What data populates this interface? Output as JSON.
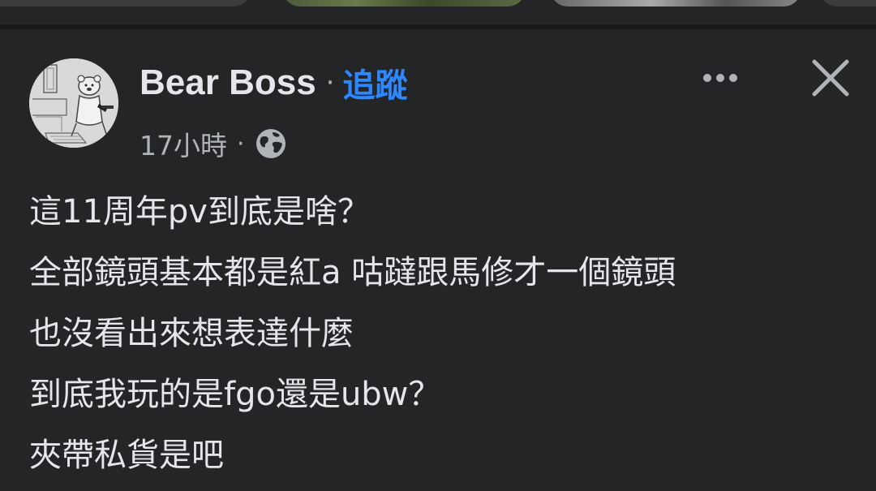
{
  "post": {
    "author": "Bear Boss",
    "separator": "·",
    "follow_label": "追蹤",
    "timestamp": "17小時",
    "meta_separator": "·",
    "privacy_icon": "globe-icon",
    "more_icon": "more-horizontal-icon",
    "close_icon": "close-icon",
    "lines": [
      "這11周年pv到底是啥？",
      "全部鏡頭基本都是紅a 咕躂跟馬修才一個鏡頭",
      "也沒看出來想表達什麼",
      "到底我玩的是fgo還是ubw？",
      "夾帶私貨是吧"
    ]
  },
  "colors": {
    "background": "#242526",
    "text_primary": "#e4e6eb",
    "text_secondary": "#b0b3b8",
    "accent": "#2d88ff"
  }
}
